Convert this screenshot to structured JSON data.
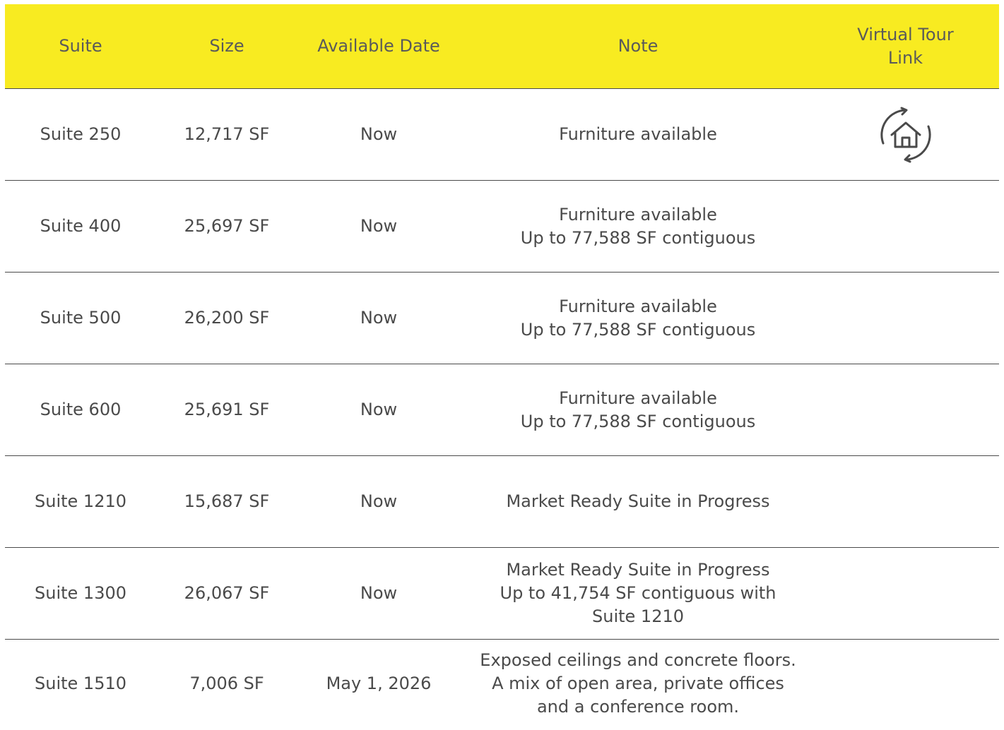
{
  "header": {
    "suite": "Suite",
    "size": "Size",
    "available_date": "Available Date",
    "note": "Note",
    "virtual_tour_line1": "Virtual Tour",
    "virtual_tour_line2": "Link"
  },
  "rows": [
    {
      "suite": "Suite 250",
      "size": "12,717 SF",
      "date": "Now",
      "note": [
        "Furniture available"
      ],
      "tour_icon": "virtual-tour-home-icon"
    },
    {
      "suite": "Suite 400",
      "size": "25,697 SF",
      "date": "Now",
      "note": [
        "Furniture available",
        "Up to 77,588 SF contiguous"
      ]
    },
    {
      "suite": "Suite 500",
      "size": "26,200 SF",
      "date": "Now",
      "note": [
        "Furniture available",
        "Up to 77,588 SF contiguous"
      ]
    },
    {
      "suite": "Suite 600",
      "size": "25,691 SF",
      "date": "Now",
      "note": [
        "Furniture available",
        "Up to 77,588 SF contiguous"
      ]
    },
    {
      "suite": "Suite 1210",
      "size": "15,687 SF",
      "date": "Now",
      "note": [
        "Market Ready Suite in Progress"
      ]
    },
    {
      "suite": "Suite 1300",
      "size": "26,067 SF",
      "date": "Now",
      "note": [
        "Market Ready Suite in Progress",
        "Up to 41,754 SF contiguous with",
        "Suite 1210"
      ]
    },
    {
      "suite": "Suite 1510",
      "size": "7,006 SF",
      "date": "May 1, 2026",
      "note": [
        "Exposed ceilings and concrete floors.",
        "A mix of open area, private offices",
        "and a conference room."
      ]
    }
  ],
  "colors": {
    "header_bg": "#f8eb21",
    "text": "#4a4a4a",
    "rule": "#4a4a4a"
  }
}
